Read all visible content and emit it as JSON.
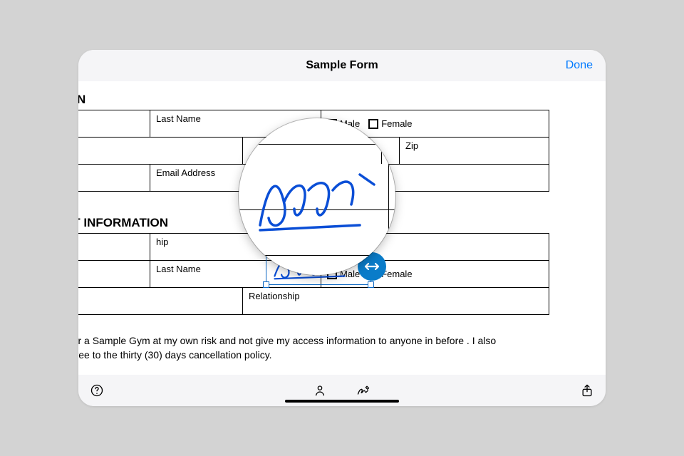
{
  "colors": {
    "accent": "#007aff",
    "handle": "#0a7cc9",
    "ink": "#0a4ed6"
  },
  "title": "Sample Form",
  "actions": {
    "done": "Done"
  },
  "section1": {
    "heading_fragment": "ION",
    "last_name_label": "Last Name",
    "male_label": "Male",
    "female_label": "Female",
    "zip_label": "Zip",
    "email_label": "Email Address"
  },
  "section2": {
    "heading_fragment": "CT INFORMATION",
    "relationship_fragment": "hip",
    "last_name_label": "Last Name",
    "male_label": "Male",
    "female_label": "Female",
    "relationship_label": "Relationship"
  },
  "paragraph": "nter a Sample Gym at my own risk and not give my access information to anyone in before . I also agree to the thirty (30) days cancellation policy.",
  "icons": {
    "help": "help-icon",
    "profile": "person-icon",
    "sign": "signature-icon",
    "share": "share-icon",
    "resize": "resize-horizontal-icon"
  }
}
